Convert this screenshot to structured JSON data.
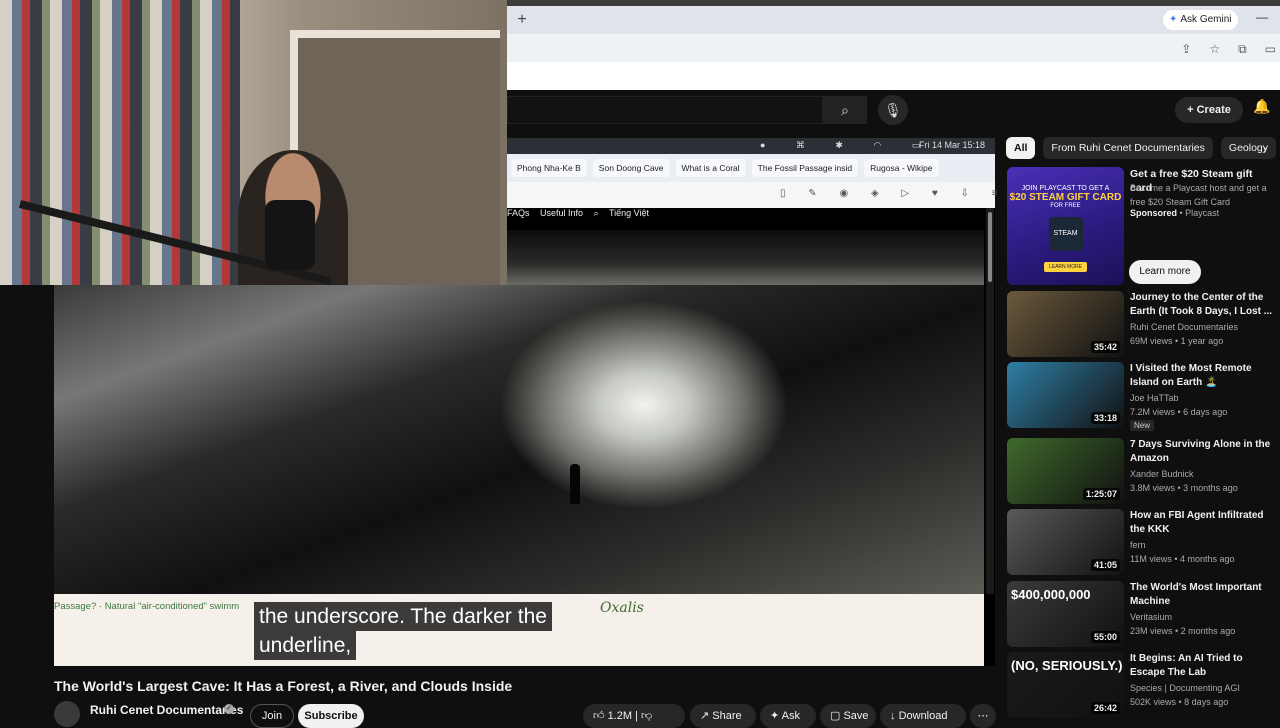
{
  "browser": {
    "new_tab_symbol": "+",
    "ask_gemini": "Ask Gemini",
    "minimize": "—",
    "addr_icons": [
      "⇪",
      "☆",
      "⧉",
      "▭"
    ]
  },
  "youtube": {
    "search_icon": "⌕",
    "mic_icon": "🎙",
    "create_label": "Create",
    "bell_icon": "🔔"
  },
  "inner_screen": {
    "clock": "Fri 14 Mar 15:18",
    "tabs": [
      "Phong Nha-Ke B",
      "Son Doong Cave",
      "What is a Coral",
      "The Fossil Passage insid",
      "Rugosa - Wikipe"
    ],
    "nav_links": [
      "FAQs",
      "Useful Info",
      "Tiếng Việt"
    ],
    "footer_links": "Passage? · Natural \"air-conditioned\" swimm",
    "oxalis": "Oxalis"
  },
  "captions": {
    "line1": "the underscore. The darker the",
    "line2": "underline,"
  },
  "video": {
    "title": "The World's Largest Cave: It Has a Forest, a River, and Clouds Inside",
    "channel": "Ruhi Cenet Documentaries",
    "join": "Join",
    "subscribe": "Subscribe",
    "likes": "1.2M",
    "share": "Share",
    "ask": "Ask",
    "save": "Save",
    "download": "Download",
    "more": "⋯"
  },
  "chips": [
    "All",
    "From Ruhi Cenet Documentaries",
    "Geology"
  ],
  "ad": {
    "title": "Get a free $20 Steam gift card",
    "desc": "Become a Playcast host and get a free $20 Steam Gift Card",
    "sponsored": "Sponsored",
    "advertiser": "Playcast",
    "learn_more": "Learn more",
    "thumb_l1": "JOIN PLAYCAST TO GET A",
    "thumb_l2": "$20 STEAM GIFT CARD",
    "thumb_l3": "FOR FREE",
    "thumb_logo": "STEAM",
    "thumb_cta": "LEARN MORE"
  },
  "recommendations": [
    {
      "title": "Journey to the Center of the Earth (It Took 8 Days, I Lost ...",
      "channel": "Ruhi Cenet Documentaries",
      "meta": "69M views • 1 year ago",
      "duration": "35:42",
      "thumb_color": "#6b5a3c"
    },
    {
      "title": "I Visited the Most Remote Island on Earth 🏝️",
      "channel": "Joe HaTTab",
      "meta": "7.2M views • 6 days ago",
      "duration": "33:18",
      "badge": "New",
      "thumb_color": "#2f7fa6"
    },
    {
      "title": "7 Days Surviving Alone in the Amazon",
      "channel": "Xander Budnick",
      "meta": "3.8M views • 3 months ago",
      "duration": "1:25:07",
      "thumb_color": "#3f6a2c"
    },
    {
      "title": "How an FBI Agent Infiltrated the KKK",
      "channel": "fern",
      "meta": "11M views • 4 months ago",
      "duration": "41:05",
      "thumb_color": "#5a5a5a"
    },
    {
      "title": "The World's Most Important Machine",
      "channel": "Veritasium",
      "meta": "23M views • 2 months ago",
      "duration": "55:00",
      "thumb_text": "$400,000,000",
      "thumb_color": "#3a3a3a"
    },
    {
      "title": "It Begins: An AI Tried to Escape The Lab",
      "channel": "Species | Documenting AGI",
      "meta": "502K views • 8 days ago",
      "duration": "26:42",
      "thumb_text": "(NO, SERIOUSLY.)",
      "thumb_color": "#1a1a1a"
    }
  ]
}
